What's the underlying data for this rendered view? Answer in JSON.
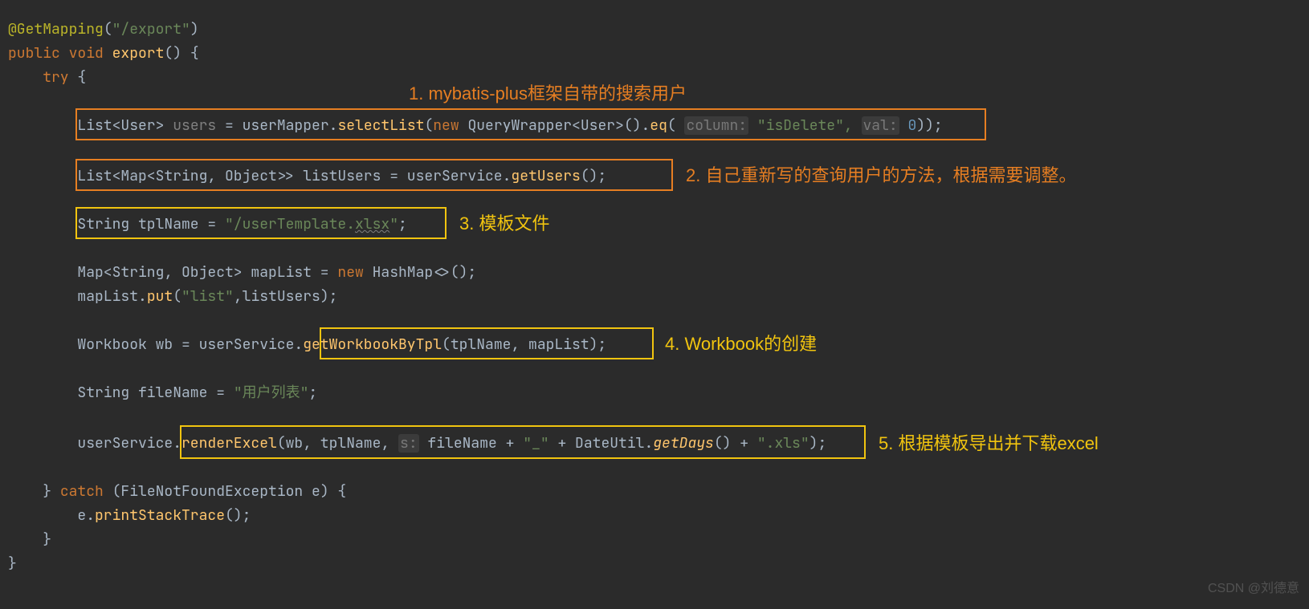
{
  "code": {
    "l1": {
      "a": "@GetMapping",
      "b": "(",
      "c": "\"/export\"",
      "d": ")"
    },
    "l2": {
      "a": "public void ",
      "b": "export",
      "c": "() {"
    },
    "l3": {
      "a": "    try ",
      "b": "{"
    },
    "l5": {
      "a": "        List<",
      "b": "User",
      "c": "> ",
      "d": "users ",
      "e": "= userMapper.",
      "f": "selectList",
      "g": "(",
      "h": "new ",
      "i": "QueryWrapper<",
      "j": "User",
      "k": ">().",
      "l": "eq",
      "m": "( ",
      "hint1": "column:",
      "n": " \"isDelete\", ",
      "hint2": "val:",
      "o": " 0",
      "p": "));"
    },
    "l7": {
      "a": "        List<Map<String, Object>> listUsers = userService.",
      "b": "getUsers",
      "c": "();"
    },
    "l9": {
      "a": "        String tplName = ",
      "b": "\"/userTemplate.",
      "c": "xlsx",
      "d": "\"",
      "e": ";"
    },
    "l11": {
      "a": "        Map<String, Object> mapList = ",
      "b": "new ",
      "c": "HashMap<>();"
    },
    "l12": {
      "a": "        mapList.",
      "b": "put",
      "c": "(",
      "d": "\"list\"",
      "e": ",listUsers);"
    },
    "l14": {
      "a": "        Workbook wb = userService.",
      "b": "getWorkbookByTpl",
      "c": "(tplName, mapList);"
    },
    "l16": {
      "a": "        String fileName = ",
      "b": "\"用户列表\"",
      "c": ";"
    },
    "l18": {
      "a": "        userService.",
      "b": "renderExcel",
      "c": "(wb, tplName, ",
      "hint": "s:",
      "d": " fileName + ",
      "e": "\"_\"",
      "f": " + DateUtil.",
      "g": "getDays",
      "h": "() + ",
      "i": "\".xls\"",
      "j": ");"
    },
    "l20": {
      "a": "    } ",
      "b": "catch ",
      "c": "(FileNotFoundException e) {"
    },
    "l21": {
      "a": "        e.",
      "b": "printStackTrace",
      "c": "();"
    },
    "l22": "    }",
    "l23": "}"
  },
  "annotations": {
    "a1": "1. mybatis-plus框架自带的搜索用户",
    "a2": "2. 自己重新写的查询用户的方法，根据需要调整。",
    "a3": "3. 模板文件",
    "a4": "4. Workbook的创建",
    "a5": "5. 根据模板导出并下载excel"
  },
  "watermark": "CSDN @刘德意"
}
